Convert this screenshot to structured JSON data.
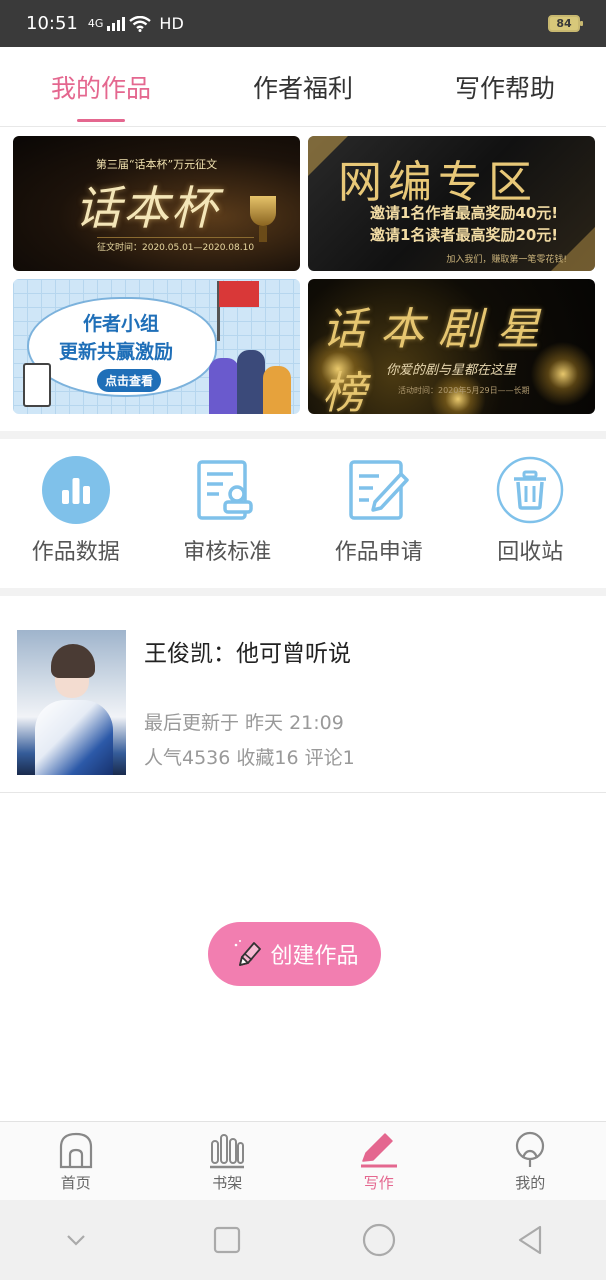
{
  "status_bar": {
    "time": "10:51",
    "network": "4G",
    "hd": "HD",
    "battery": "84"
  },
  "tabs": [
    {
      "label": "我的作品",
      "active": true
    },
    {
      "label": "作者福利",
      "active": false
    },
    {
      "label": "写作帮助",
      "active": false
    }
  ],
  "banners": {
    "b1": {
      "subtitle": "第三届“话本杯”万元征文",
      "title": "话本杯",
      "date": "征文时间：2020.05.01—2020.08.10"
    },
    "b2": {
      "title": "网编专区",
      "line1": "邀请1名作者最高奖励40元!",
      "line2": "邀请1名读者最高奖励20元!",
      "footer": "加入我们，赚取第一笔零花钱!"
    },
    "b3": {
      "line1": "作者小组",
      "line2": "更新共赢激励",
      "button": "点击查看"
    },
    "b4": {
      "title": "话本剧星榜",
      "subtitle": "你爱的剧与星都在这里",
      "date": "活动时间：2020年5月29日——长期"
    }
  },
  "tools": [
    {
      "label": "作品数据",
      "icon": "bar-chart-icon"
    },
    {
      "label": "审核标准",
      "icon": "review-stamp-icon"
    },
    {
      "label": "作品申请",
      "icon": "edit-document-icon"
    },
    {
      "label": "回收站",
      "icon": "trash-icon"
    }
  ],
  "work": {
    "title": "王俊凯：他可曾听说",
    "updated": "最后更新于 昨天 21:09",
    "stats": "人气4536 收藏16 评论1"
  },
  "create_button": {
    "label": "创建作品",
    "icon": "pencil-icon"
  },
  "bottom_nav": [
    {
      "label": "首页",
      "icon": "home-icon",
      "active": false
    },
    {
      "label": "书架",
      "icon": "bookshelf-icon",
      "active": false
    },
    {
      "label": "写作",
      "icon": "write-pen-icon",
      "active": true
    },
    {
      "label": "我的",
      "icon": "profile-icon",
      "active": false
    }
  ],
  "colors": {
    "accent": "#e4678f",
    "tool_blue": "#7fc1ea",
    "create_button": "#f27eb0"
  }
}
